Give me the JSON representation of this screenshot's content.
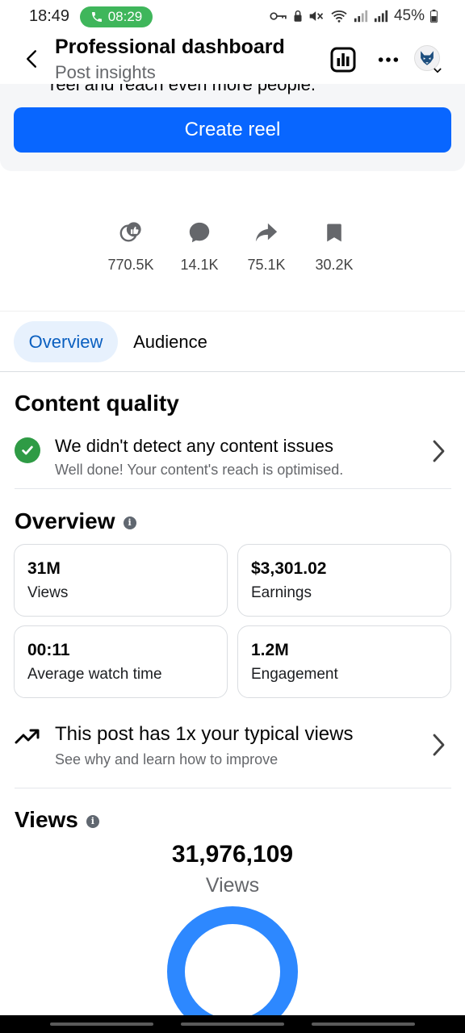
{
  "status_bar": {
    "time": "18:49",
    "call_timer": "08:29",
    "battery": "45%"
  },
  "header": {
    "title": "Professional dashboard",
    "subtitle": "Post insights",
    "icons": [
      "back-arrow-icon",
      "bar-chart-icon",
      "more-icon",
      "profile-avatar"
    ]
  },
  "reel_card": {
    "clipped_text": "reel and reach even more people.",
    "button_label": "Create reel"
  },
  "reactions": [
    {
      "icon": "reactions-icon",
      "value": "770.5K"
    },
    {
      "icon": "comment-icon",
      "value": "14.1K"
    },
    {
      "icon": "share-icon",
      "value": "75.1K"
    },
    {
      "icon": "bookmark-icon",
      "value": "30.2K"
    }
  ],
  "tabs": [
    {
      "label": "Overview",
      "selected": true
    },
    {
      "label": "Audience",
      "selected": false
    }
  ],
  "content_quality": {
    "title": "Content quality",
    "message": "We didn't detect any content issues",
    "detail": "Well done! Your content's reach is optimised."
  },
  "overview": {
    "title": "Overview",
    "metrics": [
      {
        "value": "31M",
        "label": "Views"
      },
      {
        "value": "$3,301.02",
        "label": "Earnings"
      },
      {
        "value": "00:11",
        "label": "Average watch time"
      },
      {
        "value": "1.2M",
        "label": "Engagement"
      }
    ]
  },
  "typical_views": {
    "message": "This post has 1x your typical views",
    "detail": "See why and learn how to improve"
  },
  "views": {
    "title": "Views",
    "total": "31,976,109",
    "label": "Views"
  },
  "colors": {
    "primary_blue": "#0866ff",
    "tab_selected_bg": "#e7f1fd",
    "tab_selected_text": "#0a5fc0",
    "success_green": "#2f9b45",
    "call_green": "#3fb65b",
    "donut_blue": "#2d88ff"
  }
}
